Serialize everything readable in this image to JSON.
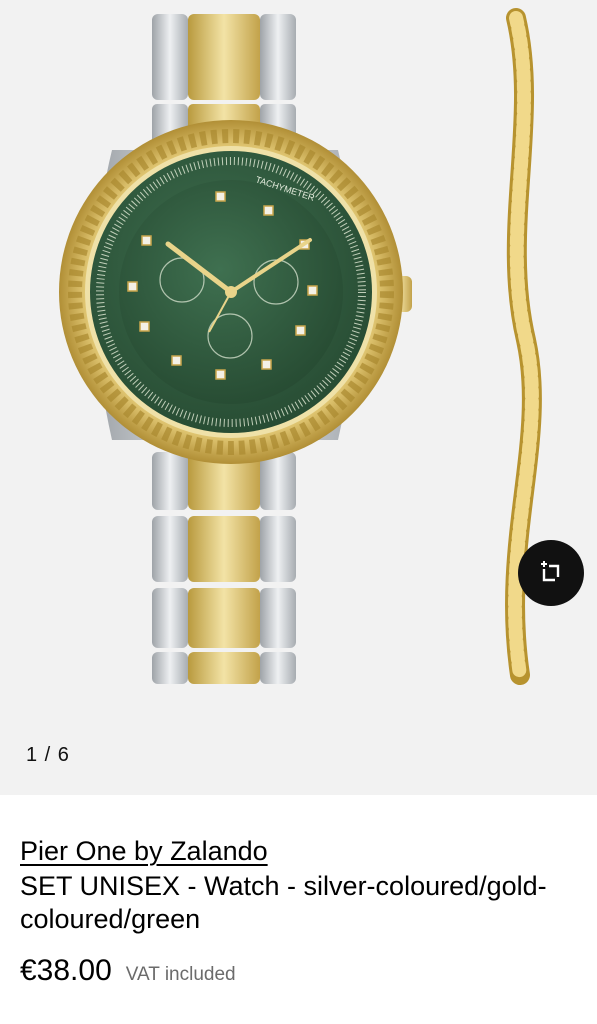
{
  "gallery": {
    "counter": "1 / 6",
    "image_alt": "Gold and silver watch with green dial beside a gold rope bracelet",
    "dial_label": "TACHYMETER",
    "similar_button_icon": "similar-items-icon"
  },
  "product": {
    "brand": "Pier One by Zalando",
    "name": "SET UNISEX - Watch - silver-coloured/gold-coloured/green",
    "price": "€38.00",
    "vat_note": "VAT included"
  },
  "colors": {
    "gallery_bg": "#f2f2f2",
    "gold": "#d8b95a",
    "silver": "#c9ccd0",
    "dial_green": "#2f5a3c",
    "button_bg": "#111111"
  }
}
